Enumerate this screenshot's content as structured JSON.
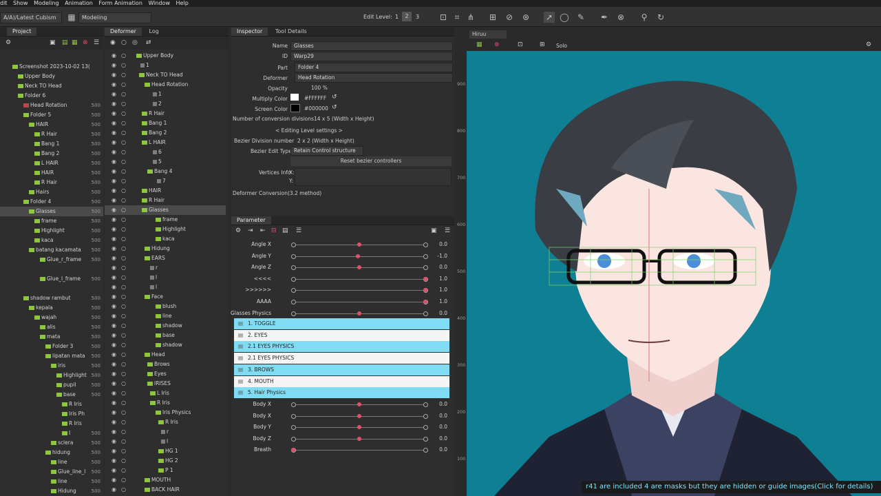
{
  "menu": [
    "dit",
    "Show",
    "Modeling",
    "Animation",
    "Form Animation",
    "Window",
    "Help"
  ],
  "toolbar": {
    "path_select": "A/A)/Latest Cubism",
    "mode_select": "Modeling",
    "edit_level_label": "Edit Level:",
    "edit_levels": [
      "1",
      "2",
      "3"
    ]
  },
  "project_panel": {
    "tab": "Project",
    "rows": [
      {
        "label": "Screenshot 2023-10-02 13(",
        "num": ""
      },
      {
        "label": "Upper Body",
        "num": ""
      },
      {
        "label": "Neck TO Head",
        "num": ""
      },
      {
        "label": "Folder 6",
        "num": ""
      },
      {
        "label": "Head Rotation",
        "num": "500"
      },
      {
        "label": "Folder 5",
        "num": "500"
      },
      {
        "label": "HAIR",
        "num": "500"
      },
      {
        "label": "R Hair",
        "num": "500"
      },
      {
        "label": "Bang 1",
        "num": "500"
      },
      {
        "label": "Bang 2",
        "num": "500"
      },
      {
        "label": "L HAIR",
        "num": "500"
      },
      {
        "label": "HAIR",
        "num": "500"
      },
      {
        "label": "R Hair",
        "num": "500"
      },
      {
        "label": "Hairs",
        "num": "500"
      },
      {
        "label": "Folder 4",
        "num": "500"
      },
      {
        "label": "Glasses",
        "num": "500"
      },
      {
        "label": "frame",
        "num": "500"
      },
      {
        "label": "Highlight",
        "num": "500"
      },
      {
        "label": "kaca",
        "num": "500"
      },
      {
        "label": "batang kacamata",
        "num": "500"
      },
      {
        "label": "Glue_r_frame",
        "num": "500"
      },
      {
        "label": "",
        "num": ""
      },
      {
        "label": "Glue_l_frame",
        "num": "500"
      },
      {
        "label": "",
        "num": ""
      },
      {
        "label": "shadow rambut",
        "num": "500"
      },
      {
        "label": "kepala",
        "num": "500"
      },
      {
        "label": "wajah",
        "num": "500"
      },
      {
        "label": "alis",
        "num": "500"
      },
      {
        "label": "mata",
        "num": "500"
      },
      {
        "label": "Folder 3",
        "num": "500"
      },
      {
        "label": "lipatan mata",
        "num": "500"
      },
      {
        "label": "iris",
        "num": "500"
      },
      {
        "label": "Highlight",
        "num": "500"
      },
      {
        "label": "pupil",
        "num": "500"
      },
      {
        "label": "base",
        "num": "500"
      },
      {
        "label": "R Iris",
        "num": ""
      },
      {
        "label": "Iris Ph",
        "num": ""
      },
      {
        "label": "R Iris",
        "num": ""
      },
      {
        "label": "I",
        "num": "500"
      },
      {
        "label": "sclera",
        "num": "500"
      },
      {
        "label": "hidung",
        "num": "500"
      },
      {
        "label": "line",
        "num": "500"
      },
      {
        "label": "Glue_line_l",
        "num": "500"
      },
      {
        "label": "line",
        "num": "500"
      },
      {
        "label": "Hidung",
        "num": "500"
      }
    ]
  },
  "deformer_panel": {
    "tabs": [
      "Deformer",
      "Log"
    ],
    "rows": [
      {
        "label": "Upper Body"
      },
      {
        "label": "1"
      },
      {
        "label": "Neck TO Head"
      },
      {
        "label": "Head Rotation"
      },
      {
        "label": "1"
      },
      {
        "label": "2"
      },
      {
        "label": "R Hair"
      },
      {
        "label": "Bang 1"
      },
      {
        "label": "Bang 2"
      },
      {
        "label": "L HAIR"
      },
      {
        "label": "6"
      },
      {
        "label": "5"
      },
      {
        "label": "Bang 4"
      },
      {
        "label": "7"
      },
      {
        "label": "HAIR"
      },
      {
        "label": "R Hair"
      },
      {
        "label": "Glasses"
      },
      {
        "label": "frame"
      },
      {
        "label": "Highlight"
      },
      {
        "label": "kaca"
      },
      {
        "label": "Hidung"
      },
      {
        "label": "EARS"
      },
      {
        "label": "r"
      },
      {
        "label": "l"
      },
      {
        "label": "l"
      },
      {
        "label": "Face"
      },
      {
        "label": "blush"
      },
      {
        "label": "line"
      },
      {
        "label": "shadow"
      },
      {
        "label": "base"
      },
      {
        "label": "shadow"
      },
      {
        "label": "Head"
      },
      {
        "label": "Brows"
      },
      {
        "label": "Eyes"
      },
      {
        "label": "IRISES"
      },
      {
        "label": "L Iris"
      },
      {
        "label": "R Iris"
      },
      {
        "label": "Iris Physics"
      },
      {
        "label": "R Iris"
      },
      {
        "label": "r"
      },
      {
        "label": "I"
      },
      {
        "label": "HG 1"
      },
      {
        "label": "HG 2"
      },
      {
        "label": "P 1"
      },
      {
        "label": "MOUTH"
      },
      {
        "label": "BACK HAIR"
      }
    ]
  },
  "inspector": {
    "tabs": [
      "Inspector",
      "Tool Details"
    ],
    "name_label": "Name",
    "name_value": "Glasses",
    "id_label": "ID",
    "id_value": "Warp29",
    "part_label": "Part",
    "part_value": "Folder 4",
    "deformer_label": "Deformer",
    "deformer_value": "Head Rotation",
    "opacity_label": "Opacity",
    "opacity_value": "100 %",
    "multiply_label": "Multiply Color",
    "multiply_value": "#FFFFFF",
    "screen_label": "Screen Color",
    "screen_value": "#000000",
    "conv_label": "Number of conversion divisions",
    "conv_value": "14  x  5 (Width x Height)",
    "editing_level": "< Editing Level settings >",
    "bezier_div_label": "Bezier Division number",
    "bezier_div_value": "2  x  2 (Width x Height)",
    "bezier_edit_label": "Bezier Edit Type",
    "bezier_edit_value": "Retain Control structure",
    "reset_button": "Reset bezier controllers",
    "vertices_label": "Vertices Info",
    "vertices_x": "X:",
    "vertices_y": "Y:",
    "conversion_label": "Deformer Conversion(3.2 method)"
  },
  "parameter": {
    "tab": "Parameter",
    "params": [
      {
        "name": "Angle X",
        "value": "0.0",
        "pos": 0.5
      },
      {
        "name": "Angle Y",
        "value": "-1.0",
        "pos": 0.49
      },
      {
        "name": "Angle Z",
        "value": "0.0",
        "pos": 0.5
      },
      {
        "name": "<<<<",
        "value": "1.0",
        "pos": 1.0
      },
      {
        "name": ">>>>>>",
        "value": "1.0",
        "pos": 1.0
      },
      {
        "name": "AAAA",
        "value": "1.0",
        "pos": 1.0
      },
      {
        "name": "Glasses Physics",
        "value": "0.0",
        "pos": 0.5
      }
    ],
    "groups": [
      {
        "name": "1. TOGGLE",
        "style": "cyan"
      },
      {
        "name": "2. EYES",
        "style": "white"
      },
      {
        "name": "2.1 EYES PHYSICS",
        "style": "cyan"
      },
      {
        "name": "2.1 EYES PHYSICS",
        "style": "white"
      },
      {
        "name": "3. BROWS",
        "style": "cyan"
      },
      {
        "name": "4. MOUTH",
        "style": "white"
      },
      {
        "name": "5. Hair Physics",
        "style": "cyan"
      }
    ],
    "params2": [
      {
        "name": "Body X",
        "value": "0.0",
        "pos": 0.5
      },
      {
        "name": "Body X",
        "value": "0.0",
        "pos": 0.5
      },
      {
        "name": "Body Y",
        "value": "0.0",
        "pos": 0.5
      },
      {
        "name": "Body Z",
        "value": "0.0",
        "pos": 0.5
      },
      {
        "name": "Breath",
        "value": "0.0",
        "pos": 0.0
      }
    ]
  },
  "viewport": {
    "tab": "Hiruu",
    "solo_label": "Solo",
    "ruler_labels": [
      "900",
      "800",
      "700",
      "600",
      "500",
      "400",
      "300",
      "200",
      "100"
    ],
    "status_text": "r41 are included 4 are masks but they are hidden or guide images(Click for details)"
  },
  "colors": {
    "accent": "#7fdcf2",
    "knob": "#e0506a",
    "viewport_bg": "#0f7f94"
  }
}
